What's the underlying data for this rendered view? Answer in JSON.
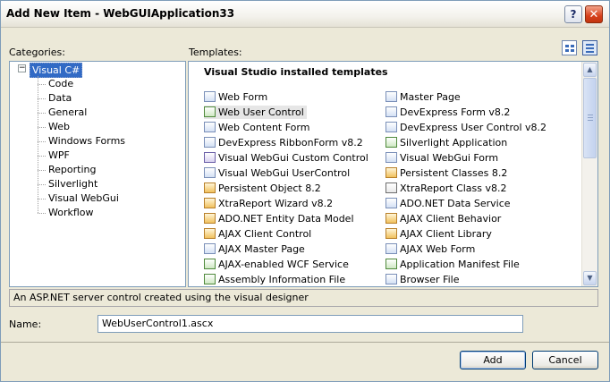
{
  "window": {
    "title": "Add New Item - WebGUIApplication33",
    "help_glyph": "?",
    "close_glyph": "✕"
  },
  "categories": {
    "label": "Categories:",
    "root": "Visual C#",
    "expander": "−",
    "items": [
      "Code",
      "Data",
      "General",
      "Web",
      "Windows Forms",
      "WPF",
      "Reporting",
      "Silverlight",
      "Visual WebGui",
      "Workflow"
    ]
  },
  "templates": {
    "label": "Templates:",
    "header": "Visual Studio installed templates",
    "left_column": [
      {
        "label": "Web Form",
        "icon": "web-form-icon"
      },
      {
        "label": "Web User Control",
        "icon": "web-user-control-icon",
        "selected": true
      },
      {
        "label": "Web Content Form",
        "icon": "web-content-form-icon"
      },
      {
        "label": "DevExpress RibbonForm v8.2",
        "icon": "ribbon-form-icon"
      },
      {
        "label": "Visual WebGui Custom Control",
        "icon": "custom-control-icon"
      },
      {
        "label": "Visual WebGui UserControl",
        "icon": "user-control-icon"
      },
      {
        "label": "Persistent Object 8.2",
        "icon": "persistent-object-icon"
      },
      {
        "label": "XtraReport Wizard v8.2",
        "icon": "report-wizard-icon"
      },
      {
        "label": "ADO.NET Entity Data Model",
        "icon": "entity-model-icon"
      },
      {
        "label": "AJAX Client Control",
        "icon": "ajax-client-control-icon"
      },
      {
        "label": "AJAX Master Page",
        "icon": "ajax-master-page-icon"
      },
      {
        "label": "AJAX-enabled WCF Service",
        "icon": "wcf-service-icon"
      },
      {
        "label": "Assembly Information File",
        "icon": "assembly-info-icon"
      }
    ],
    "right_column": [
      {
        "label": "Master Page",
        "icon": "master-page-icon"
      },
      {
        "label": "DevExpress Form v8.2",
        "icon": "devexpress-form-icon"
      },
      {
        "label": "DevExpress User Control v8.2",
        "icon": "devexpress-user-control-icon"
      },
      {
        "label": "Silverlight Application",
        "icon": "silverlight-icon"
      },
      {
        "label": "Visual WebGui Form",
        "icon": "webgui-form-icon"
      },
      {
        "label": "Persistent Classes 8.2",
        "icon": "persistent-classes-icon"
      },
      {
        "label": "XtraReport Class v8.2",
        "icon": "report-class-icon"
      },
      {
        "label": "ADO.NET Data Service",
        "icon": "data-service-icon"
      },
      {
        "label": "AJAX Client Behavior",
        "icon": "ajax-behavior-icon"
      },
      {
        "label": "AJAX Client Library",
        "icon": "ajax-library-icon"
      },
      {
        "label": "AJAX Web Form",
        "icon": "ajax-web-form-icon"
      },
      {
        "label": "Application Manifest File",
        "icon": "manifest-icon"
      },
      {
        "label": "Browser File",
        "icon": "browser-file-icon"
      }
    ],
    "scroll_up": "▲",
    "scroll_down": "▼"
  },
  "description": "An ASP.NET server control created using the visual designer",
  "name": {
    "label": "Name:",
    "value": "WebUserControl1.ascx"
  },
  "buttons": {
    "add": "Add",
    "cancel": "Cancel"
  },
  "colors": {
    "selection": "#316ac5",
    "dialog_face": "#ece9d8",
    "close_button": "#d6401a"
  }
}
